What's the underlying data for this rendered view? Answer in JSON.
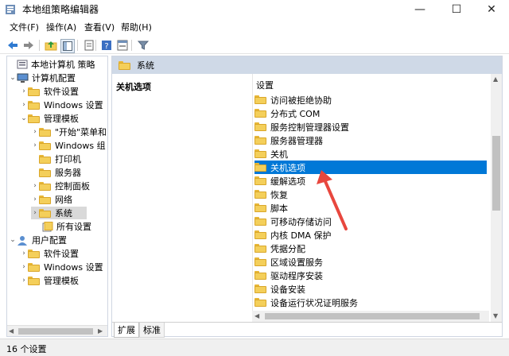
{
  "window": {
    "title": "本地组策略编辑器",
    "minimize": "—",
    "maximize": "☐",
    "close": "✕"
  },
  "menu": [
    "文件(F)",
    "操作(A)",
    "查看(V)",
    "帮助(H)"
  ],
  "toolbar_icons": [
    "back-arrow-icon",
    "forward-arrow-icon",
    "folder-up-icon",
    "show-tree-icon",
    "export-list-icon",
    "help-icon",
    "properties-icon",
    "filter-icon"
  ],
  "tree": {
    "root": "本地计算机 策略",
    "computer_config": "计算机配置",
    "software_settings": "软件设置",
    "windows_settings": "Windows 设置",
    "admin_templates": "管理模板",
    "start_menu": "\"开始\"菜单和",
    "windows_components": "Windows 组",
    "printers": "打印机",
    "server": "服务器",
    "control_panel": "控制面板",
    "network": "网络",
    "system": "系统",
    "all_settings": "所有设置",
    "user_config": "用户配置",
    "user_software_settings": "软件设置",
    "user_windows_settings": "Windows 设置",
    "user_admin_templates": "管理模板"
  },
  "right": {
    "header": "系统",
    "desc_title": "关机选项",
    "list_header": "设置",
    "items": [
      "访问被拒绝协助",
      "分布式 COM",
      "服务控制管理器设置",
      "服务器管理器",
      "关机",
      "关机选项",
      "缓解选项",
      "恢复",
      "脚本",
      "可移动存储访问",
      "内核 DMA 保护",
      "凭据分配",
      "区域设置服务",
      "驱动程序安装",
      "设备安装",
      "设备运行状况证明服务"
    ],
    "selected_index": 5
  },
  "tabs": [
    "扩展",
    "标准"
  ],
  "status": "16 个设置",
  "colors": {
    "selection": "#0078d7",
    "header_bg": "#cfd9e7",
    "arrow": "#e8473e"
  }
}
